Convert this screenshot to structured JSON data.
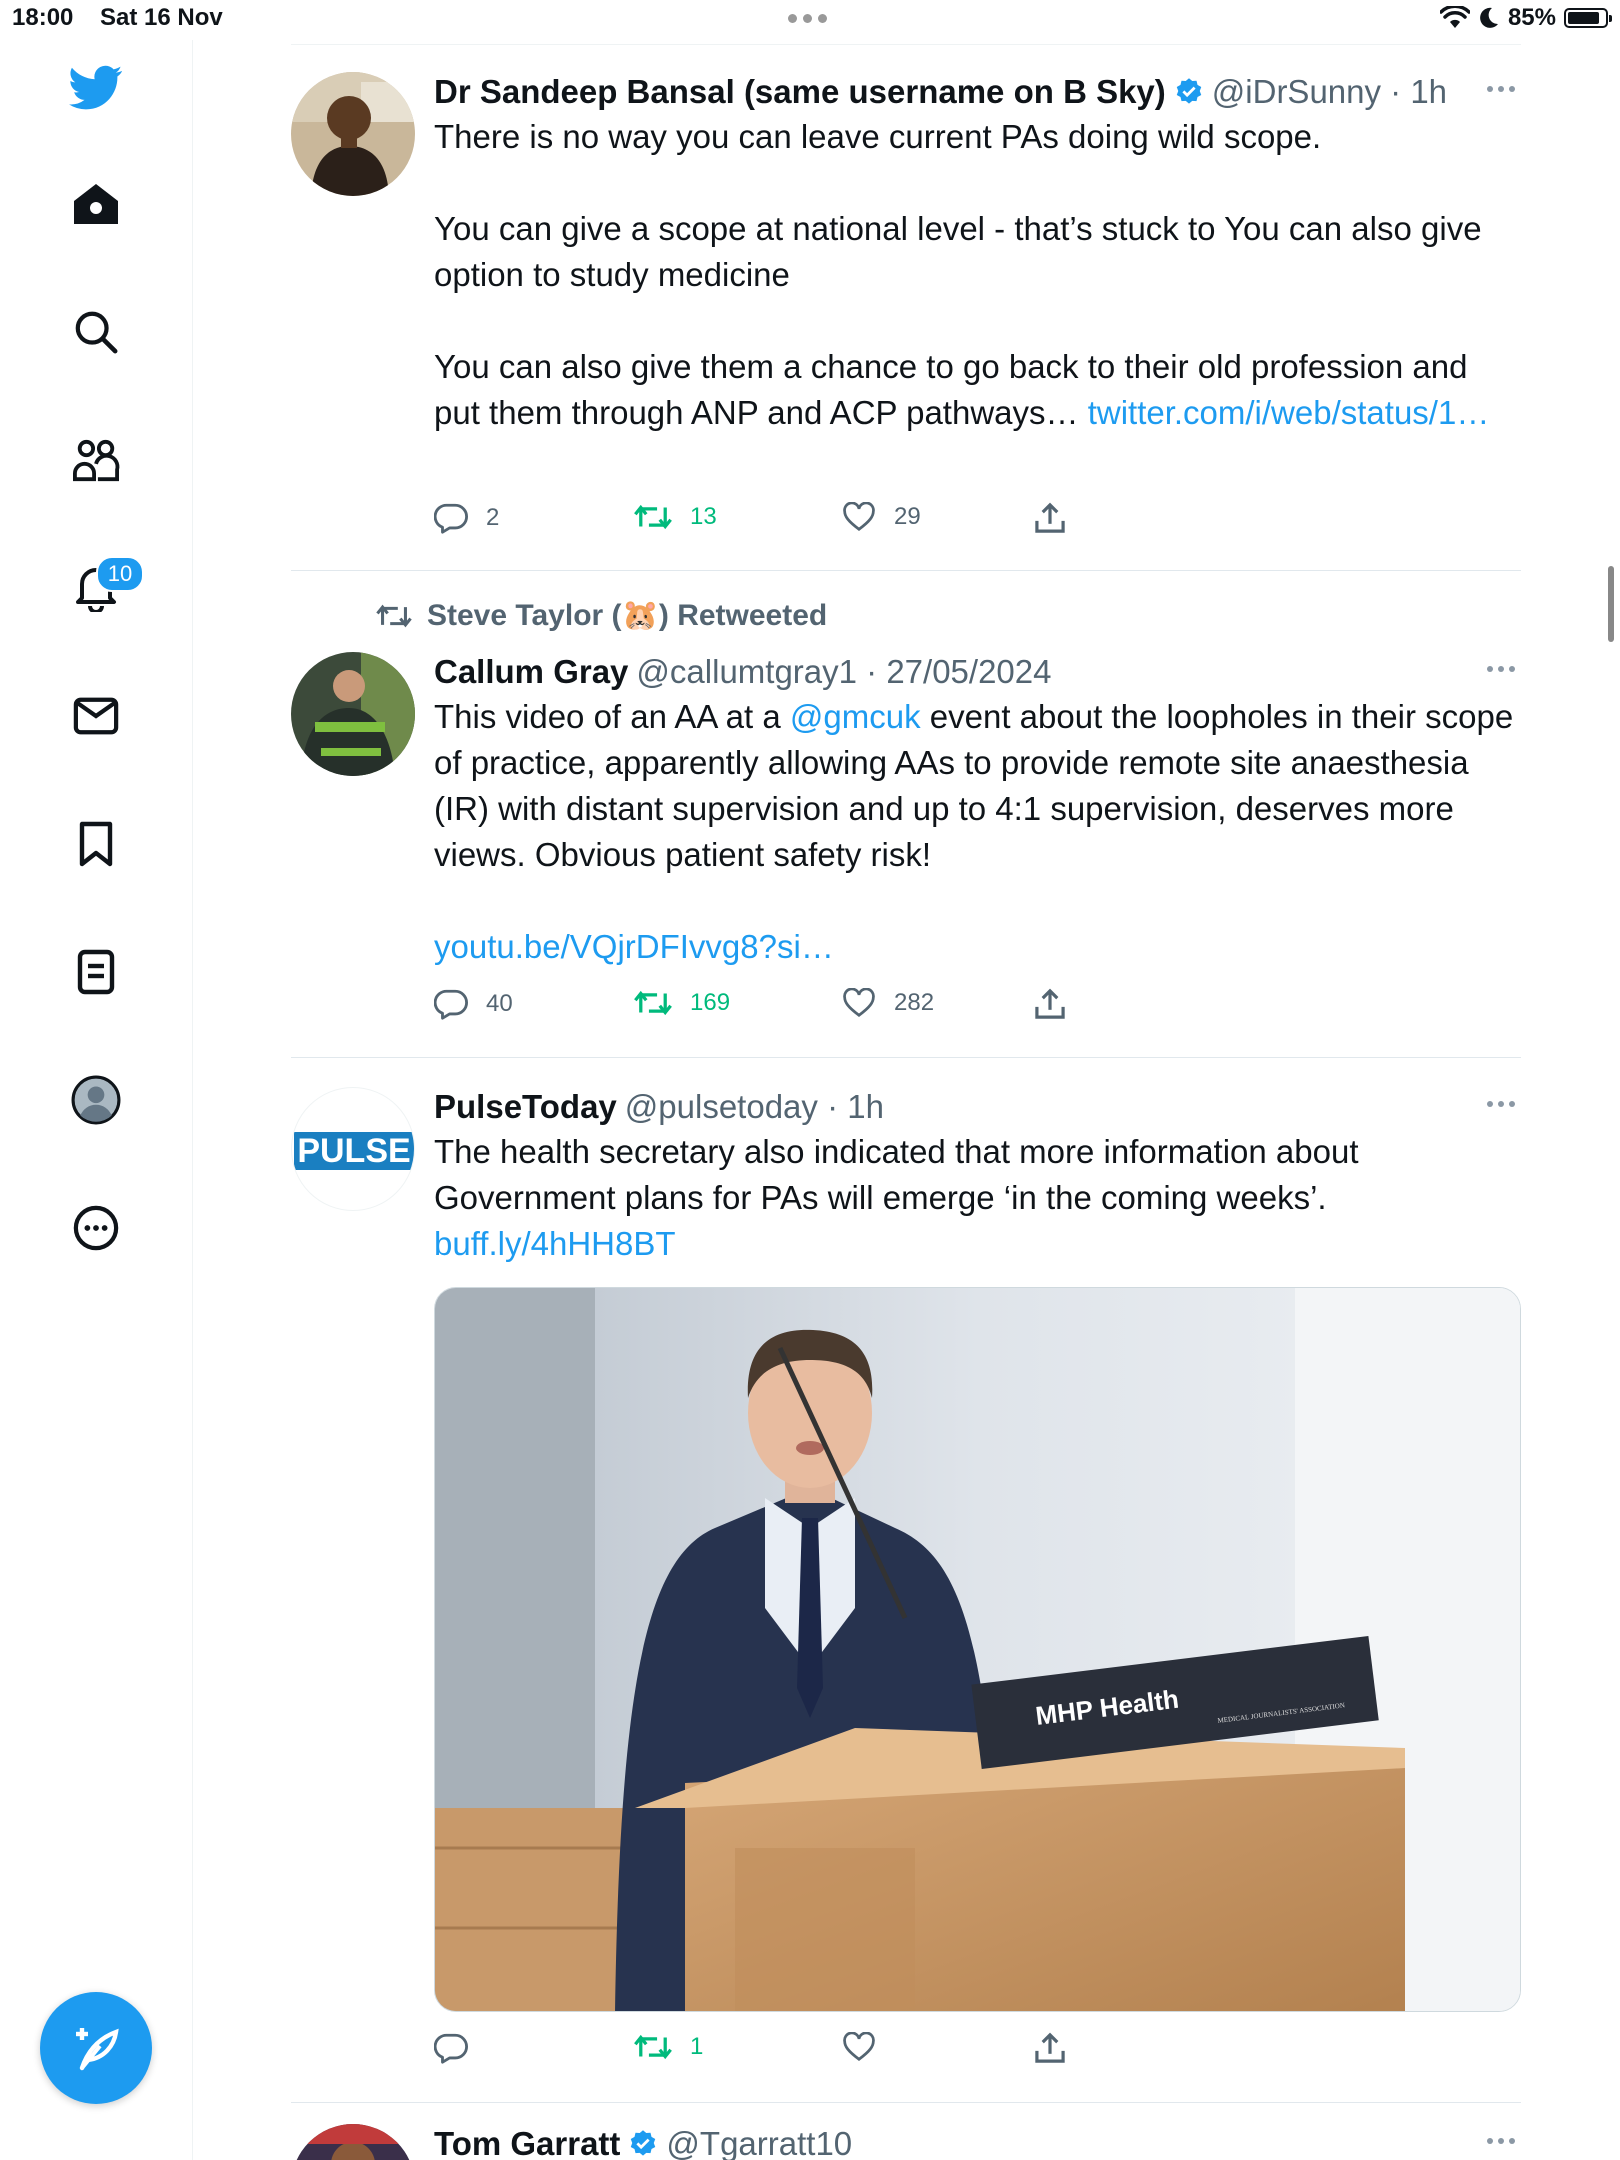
{
  "status_bar": {
    "time": "18:00",
    "date": "Sat 16 Nov",
    "battery": "85%",
    "battery_level": 0.85
  },
  "sidebar": {
    "items": [
      {
        "name": "home"
      },
      {
        "name": "explore"
      },
      {
        "name": "communities"
      },
      {
        "name": "notifications",
        "badge": "10"
      },
      {
        "name": "messages"
      },
      {
        "name": "bookmarks"
      },
      {
        "name": "lists"
      },
      {
        "name": "profile"
      },
      {
        "name": "more"
      }
    ]
  },
  "colors": {
    "accent": "#1d9bf0",
    "retweet": "#00ba7c",
    "muted": "#536471"
  },
  "tweets": [
    {
      "name": "Dr Sandeep Bansal (same username on B Sky)",
      "handle": "@iDrSunny · 1h",
      "verified": true,
      "paragraphs": [
        "There is no way you can leave current PAs doing wild scope.",
        "You can give a scope at national level - that’s stuck to   You can also give option to study medicine",
        "You can also give them a chance to go back to their old profession and put them through ANP and ACP pathways… "
      ],
      "link": "twitter.com/i/web/status/1…",
      "replies": "2",
      "retweets": "13",
      "likes": "29"
    },
    {
      "context": "Steve Taylor (🐹) Retweeted",
      "name": "Callum Gray",
      "handle": "@callumtgray1 · 27/05/2024",
      "text_before": "This video of an AA at a ",
      "mention": "@gmcuk",
      "text_after": " event about the loopholes in their scope of practice, apparently allowing AAs to provide remote site anaesthesia (IR) with distant supervision and up to 4:1 supervision, deserves more views.  Obvious patient safety risk!",
      "link": "youtu.be/VQjrDFIvvg8?si…",
      "replies": "40",
      "retweets": "169",
      "likes": "282"
    },
    {
      "name": "PulseToday",
      "handle": "@pulsetoday · 1h",
      "avatar_text": "PULSE",
      "text": "The health secretary also indicated that more information about Government plans for PAs will emerge ‘in the coming weeks’. ",
      "link": "buff.ly/4hHH8BT",
      "podium_text": "MHP Health",
      "podium_small": "MEDICAL JOURNALISTS' ASSOCIATION",
      "retweets": "1"
    },
    {
      "name": "Tom Garratt",
      "handle": "@Tgarratt10",
      "verified": true
    }
  ]
}
